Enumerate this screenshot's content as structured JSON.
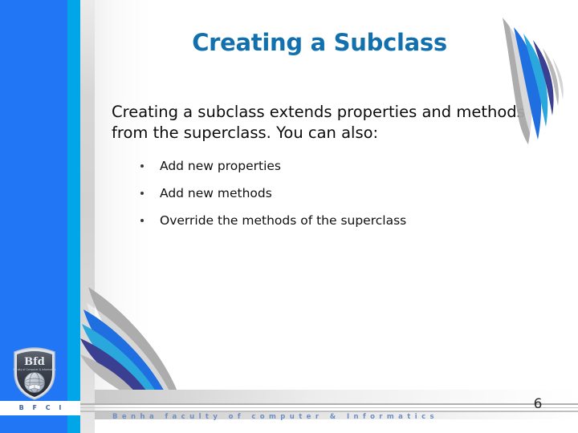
{
  "slide": {
    "title": "Creating a Subclass",
    "page_number": "6",
    "title_color": "#1270ae",
    "sidebar_blue": "#2176f5",
    "sidebar_cyan": "#00a6e8",
    "sidebar_gray": "#d2d2d2"
  },
  "body": {
    "paragraph_line1": "Creating a subclass extends properties and methods",
    "paragraph_line2": "from the superclass. You can also:",
    "bullets": [
      {
        "label": "Add new properties"
      },
      {
        "label": "Add new methods"
      },
      {
        "label": "Override the methods of the superclass"
      }
    ]
  },
  "branding": {
    "logo_mark": "Bfd",
    "logo_tagline": "Faculty of Computer & Informatics",
    "logo_abbr": "B F C I",
    "footer_text": "Benha faculty of computer & Informatics",
    "footer_text_color": "#6d8fc4"
  },
  "decorations": {
    "swoosh_top_right": "swoosh-feather-icon",
    "swoosh_bottom_left": "swoosh-feather-icon",
    "swoosh_colors": [
      "#9c9c9c",
      "#1f6fe0",
      "#2aa8dd",
      "#3b3f91",
      "#b7b7b7"
    ]
  }
}
